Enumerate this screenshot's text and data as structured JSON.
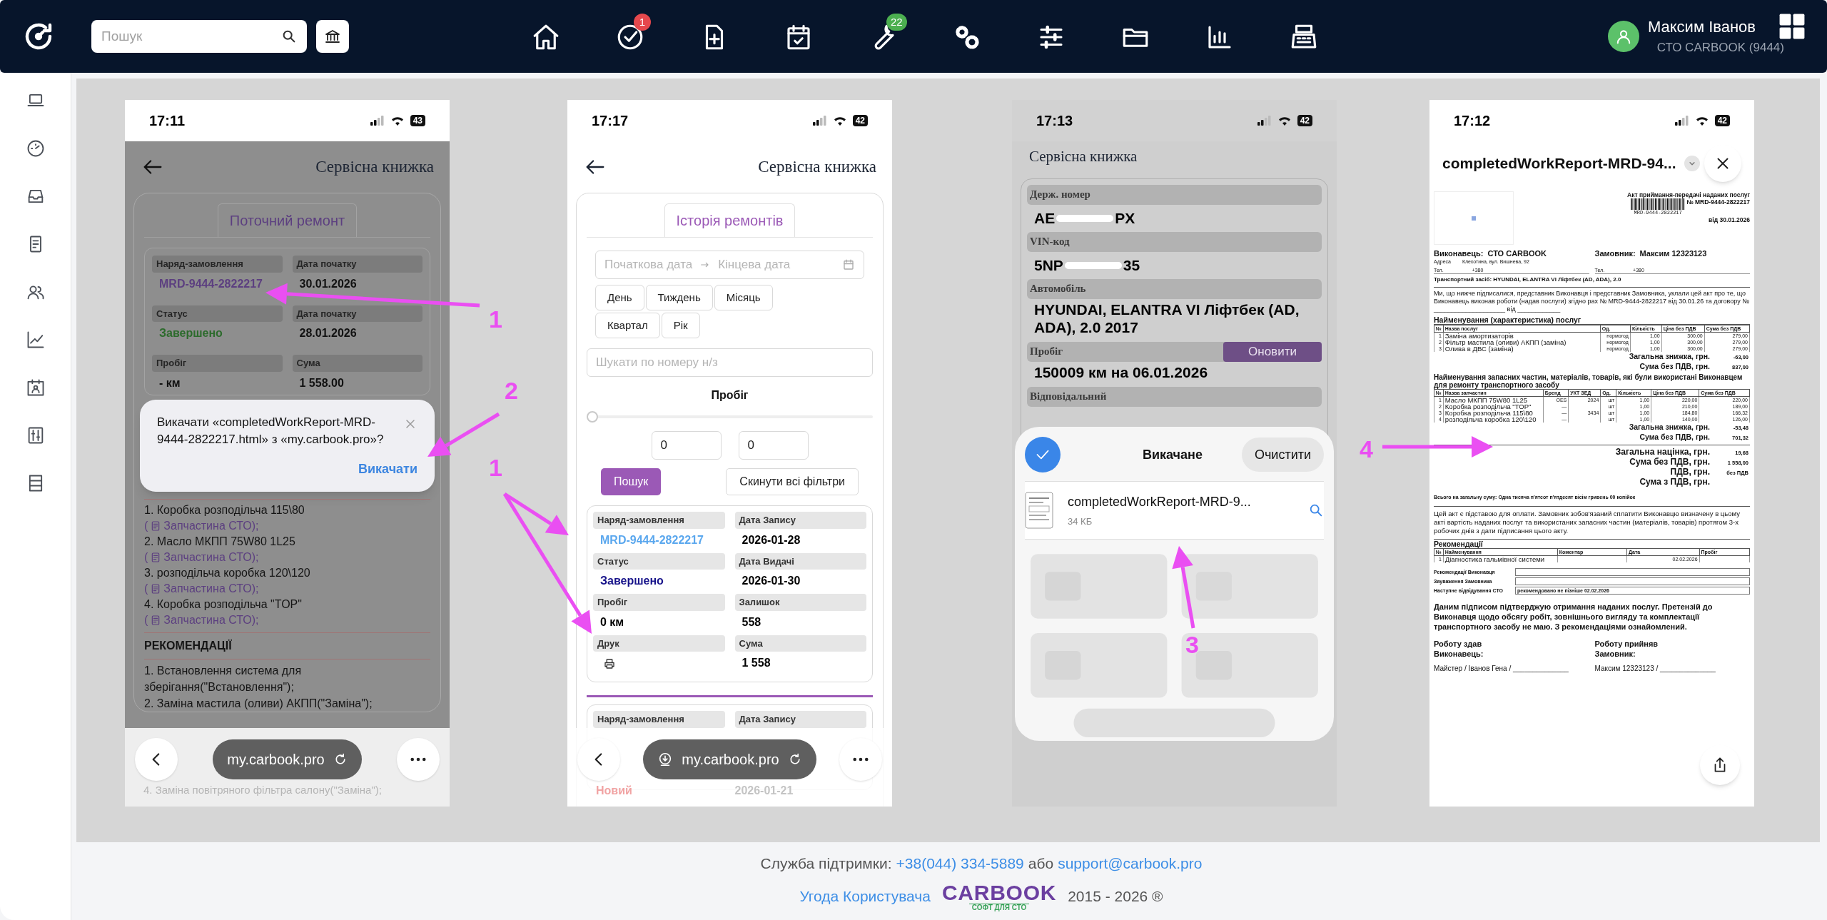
{
  "header": {
    "search_placeholder": "Пошук",
    "nav": [
      {
        "kind": "home"
      },
      {
        "kind": "check",
        "badge": "1",
        "color": "#e5484d"
      },
      {
        "kind": "file_plus"
      },
      {
        "kind": "calendar"
      },
      {
        "kind": "wrench",
        "badge": "22",
        "color": "#4caf50"
      },
      {
        "kind": "gears"
      },
      {
        "kind": "sliders"
      },
      {
        "kind": "folder"
      },
      {
        "kind": "chart"
      },
      {
        "kind": "register"
      }
    ],
    "user": {
      "name": "Максим Іванов",
      "company": "СТО CARBOOK (9444)"
    }
  },
  "sidebar": {
    "items": [
      {
        "kind": "laptop"
      },
      {
        "kind": "gauge"
      },
      {
        "kind": "inbox"
      },
      {
        "kind": "document"
      },
      {
        "kind": "users"
      },
      {
        "kind": "line_chart"
      },
      {
        "kind": "calendar_person"
      },
      {
        "kind": "sliders_box"
      },
      {
        "kind": "list"
      }
    ]
  },
  "screenshots": [
    {
      "kind": "download_prompt",
      "time": "17:11",
      "battery": "43",
      "title": "Сервісна книжка",
      "tab": "Поточний ремонт",
      "fields": [
        {
          "label": "Наряд-замовлення",
          "value": "MRD-9444-2822217",
          "color": "#5c3f80"
        },
        {
          "label": "Дата початку",
          "value": "30.01.2026"
        },
        {
          "label": "Статус",
          "value": "Завершено",
          "color": "#2c6b2c"
        },
        {
          "label": "Дата початку",
          "value": "28.01.2026"
        },
        {
          "label": "Пробіг",
          "value": "- км"
        },
        {
          "label": "Сума",
          "value": "1 558.00"
        }
      ],
      "dialog": {
        "message": "Викачати «completedWorkReport-MRD-9444-2822217.html» з «my.carbook.pro»?",
        "action": "Викачати"
      },
      "parts": [
        {
          "name": "1. Коробка розподільча 115\\80",
          "open": "(",
          "source": "Запчастина СТО);"
        },
        {
          "name": "2. Масло МКПП 75W80 1L25",
          "open": "(",
          "source": "Запчастина СТО);"
        },
        {
          "name": "3. розподільча коробка 120\\120",
          "open": "(",
          "source": "Запчастина СТО);"
        },
        {
          "name": "4. Коробка розподільча \"TOP\"",
          "open": "(",
          "source": "Запчастина СТО);"
        }
      ],
      "recommendations_title": "РЕКОМЕНДАЦІЇ",
      "recommendations": [
        {
          "text": "1. Встановлення система для зберігання(\"Встановлення\");",
          "faded": false
        },
        {
          "text": "2. Заміна мастила (оливи) АКПП(\"Заміна\");",
          "faded": false
        },
        {
          "text": "4. Заміна повітряного фільтра салону(\"Заміна\");",
          "faded": true
        }
      ],
      "url": "my.carbook.pro",
      "download_indicator": false
    },
    {
      "kind": "repair_history",
      "time": "17:17",
      "battery": "42",
      "title": "Сервісна книжка",
      "tab": "Історія ремонтів",
      "date_start_placeholder": "Початкова дата",
      "date_end_placeholder": "Кінцева дата",
      "periods": [
        "День",
        "Тиждень",
        "Місяць",
        "Квартал",
        "Рік"
      ],
      "search_placeholder": "Шукати по номеру н/з",
      "mileage_label": "Пробіг",
      "slider": {
        "level": 0
      },
      "mileage_from": "0",
      "mileage_to": "0",
      "search_button": "Пошук",
      "reset_button": "Скинути всі фільтри",
      "fields": [
        {
          "label": "Наряд-замовлення",
          "value": "MRD-9444-2822217",
          "color": "#5aa7ee"
        },
        {
          "label": "Дата Запису",
          "value": "2026-01-28"
        },
        {
          "label": "Статус",
          "value": "Завершено",
          "color": "#17138a"
        },
        {
          "label": "Дата Видачі",
          "value": "2026-01-30"
        },
        {
          "label": "Пробіг",
          "value": "0 км"
        },
        {
          "label": "Залишок",
          "value": "558"
        },
        {
          "label": "Друк",
          "kind": "print"
        },
        {
          "label": "Сума",
          "value": "1 558"
        }
      ],
      "next_record": {
        "labels": [
          "Наряд-замовлення",
          "Дата Запису"
        ],
        "values": [
          {
            "text": "Новий",
            "color": "#f1a3a3"
          },
          {
            "text": "2026-01-21",
            "color": "#c4c4c4"
          }
        ]
      },
      "url": "my.carbook.pro",
      "download_indicator": true
    },
    {
      "kind": "downloads_sheet",
      "time": "17:13",
      "battery": "42",
      "title": "Сервісна книжка",
      "fields": [
        {
          "label": "Держ. номер",
          "redacted": true,
          "value_start": "AE",
          "value_end": "PX"
        },
        {
          "label": "VIN-код",
          "redacted": true,
          "value_start": "5NP",
          "value_end": "35"
        },
        {
          "label": "Автомобіль",
          "redacted": false,
          "value": "HYUNDAI, ELANTRA VI Ліфтбек (AD, ADA), 2.0 2017"
        },
        {
          "label": "Пробіг",
          "redacted": false,
          "value": "150009 км на 06.01.2026",
          "action": "Оновити"
        },
        {
          "label": "Відповідальний",
          "redacted": false
        }
      ],
      "sheet": {
        "title": "Викачане",
        "clear": "Очистити",
        "file_name": "completedWorkReport-MRD-9...",
        "file_size": "34 КБ"
      }
    },
    {
      "kind": "document_viewer",
      "time": "17:12",
      "battery": "42",
      "title": "completedWorkReport-MRD-94...",
      "document": {
        "act_title": "Акт приймання-передачі наданих послуг",
        "act_number": "№ MRD-9444-2822217",
        "act_date": "від 30.01.2026",
        "barcode_caption": "MRD-9444-2822217",
        "executor_label": "Виконавець:",
        "executor": "СТО CARBOOK",
        "customer_label": "Замовник:",
        "customer": "Максим 12323123",
        "address_label": "Адреса",
        "address": "Клехотина, вул. Вишнева, 92",
        "contacts": [
          {
            "label": "Тел.",
            "value": "+380"
          },
          {
            "label": "Тел.",
            "value": "+380"
          }
        ],
        "vehicle": "Транспортний засіб: HYUNDAI, ELANTRA VI Ліфтбек (AD, ADA), 2.0",
        "intro": "Ми, що нижче підписалися, представник Виконавця і представник Замовника, уклали цей акт про те, що Виконавець виконав роботи (надав послуги) згідно рах № MRD-9444-2822217 від 30.01.26 та договору № ____________________ від ____________",
        "services_title": "Найменування (характеристика) послуг",
        "services_columns": [
          "№",
          "Назва послуг",
          "Од.",
          "Кількість",
          "Ціна без ПДВ",
          "Сума без ПДВ"
        ],
        "services": [
          {
            "n": "1",
            "name": "Заміна амортизаторів",
            "unit": "нормогод",
            "qty": "1,00",
            "price": "300,00",
            "sum": "279,00"
          },
          {
            "n": "2",
            "name": "Фільтр мастила (оливи) АКПП (заміна)",
            "unit": "нормогод",
            "qty": "1,00",
            "price": "300,00",
            "sum": "279,00"
          },
          {
            "n": "3",
            "name": "Олива в ДВС (заміна)",
            "unit": "нормогод",
            "qty": "1,00",
            "price": "300,00",
            "sum": "279,00"
          }
        ],
        "services_totals": [
          [
            "Загальна знижка, грн.",
            "-63,00"
          ],
          [
            "Сума без ПДВ, грн.",
            "837,00"
          ]
        ],
        "parts_title": "Найменування запасних частин, матеріалів, товарів, які були використані Виконавцем для ремонту транспортного засобу",
        "parts_columns": [
          "№",
          "Назва запчастин",
          "Бренд",
          "УКТ ЗЕД",
          "Од.",
          "Кількість",
          "Ціна без ПДВ",
          "Сума без ПДВ"
        ],
        "parts": [
          {
            "n": "1",
            "name": "Масло МКПП 75W80 1L25",
            "brand": "OES",
            "code": "2024",
            "unit": "шт",
            "qty": "1,00",
            "price": "220,00",
            "sum": "220,00"
          },
          {
            "n": "2",
            "name": "Коробка розподільча \"TOP\"",
            "brand": "—",
            "unit": "шт",
            "qty": "1,00",
            "price": "210,00",
            "sum": "189,00"
          },
          {
            "n": "3",
            "name": "Коробка розподільча 115\\80",
            "brand": "—",
            "code": "3434",
            "unit": "шт",
            "qty": "1,00",
            "price": "184,80",
            "sum": "166,32"
          },
          {
            "n": "4",
            "name": "розподільча коробка 120\\120",
            "brand": "—",
            "unit": "шт",
            "qty": "1,00",
            "price": "140,00",
            "sum": "126,00"
          }
        ],
        "parts_totals": [
          [
            "Загальна знижка, грн.",
            "-53,48"
          ],
          [
            "Сума без ПДВ, грн.",
            "701,32"
          ]
        ],
        "grand_totals": [
          [
            "Загальна націнка, грн.",
            "19,68"
          ],
          [
            "Сума без ПДВ, грн.",
            "1 558,00"
          ],
          [
            "ПДВ, грн.",
            "без ПДВ"
          ],
          [
            "Сума з ПДВ, грн."
          ]
        ],
        "total_words": "Всього на загальну суму: Одна тисяча п'ятсот п'ятдесят вісім гривень 00 копійок",
        "payment_note": "Цей акт є підставою для оплати. Замовник зобов'язаний сплатити Виконавцю визначену в цьому акті вартість наданих послуг та використаних запасних частин (матеріалів, товарів) протягом 3-х робочих днів з дати підписання цього акту.",
        "recommendations_title": "Рекомендації",
        "recommendations_columns": [
          "№",
          "Найменування",
          "Коментар",
          "Дата",
          "Пробіг"
        ],
        "recommendations": [
          {
            "n": "1",
            "name": "Діагностика гальмівної системи",
            "date": "02.02.2026"
          }
        ],
        "notes": [
          {
            "label": "Рекомендації Виконавця"
          },
          {
            "label": "Зауваження Замовника"
          },
          {
            "label": "Наступне відвідування СТО",
            "value": "рекомендовано не пізніше 02.02.2026"
          }
        ],
        "confirmation": "Даним підписом підтверджую отримання наданих послуг. Претензій до Виконавця щодо обсягу робіт, зовнішнього вигляду та комплектації транспортного засобу не маю. З рекомендаціями ознайомлений.",
        "signatures": [
          {
            "title": [
              "Роботу здав",
              "Виконавець:"
            ],
            "name": "Майстер / Іванов Гена / ______________"
          },
          {
            "title": [
              "Роботу прийняв",
              "Замовник:"
            ],
            "name": "Максим 12323123 / ______________"
          }
        ]
      }
    }
  ],
  "annotations": [
    {
      "label": "1"
    },
    {
      "label": "2"
    },
    {
      "label": "1"
    },
    {
      "label": "3"
    },
    {
      "label": "4"
    }
  ],
  "footer": {
    "support_label": "Служба підтримки:",
    "phone": "+38(044) 334-5889",
    "or": "або",
    "email": "support@carbook.pro",
    "agreement": "Угода Користувача",
    "logo": "CARBOOK",
    "logo_tagline": "СОФТ ДЛЯ СТО",
    "years": "2015 - 2026 ®"
  }
}
